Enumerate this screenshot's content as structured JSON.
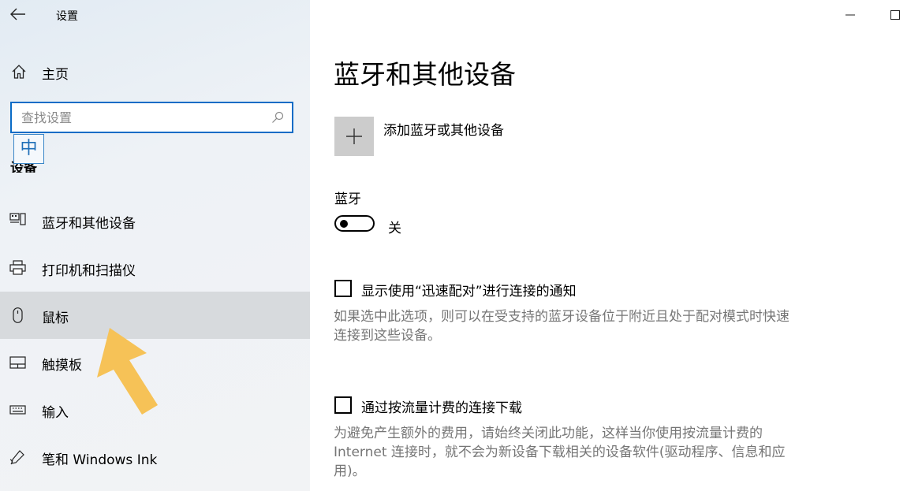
{
  "window": {
    "title": "设置"
  },
  "sidebar": {
    "home_label": "主页",
    "search_placeholder": "查找设置",
    "ime_indicator": "中",
    "section_heading": "设备",
    "items": [
      {
        "label": "蓝牙和其他设备",
        "icon": "bluetooth-devices-icon"
      },
      {
        "label": "打印机和扫描仪",
        "icon": "printer-icon"
      },
      {
        "label": "鼠标",
        "icon": "mouse-icon",
        "selected": true
      },
      {
        "label": "触摸板",
        "icon": "touchpad-icon"
      },
      {
        "label": "输入",
        "icon": "keyboard-icon"
      },
      {
        "label": "笔和 Windows Ink",
        "icon": "pen-icon"
      }
    ]
  },
  "main": {
    "title": "蓝牙和其他设备",
    "add_device_label": "添加蓝牙或其他设备",
    "bluetooth": {
      "label": "蓝牙",
      "state_label": "关",
      "on": false
    },
    "swift_pair": {
      "label": "显示使用“迅速配对”进行连接的通知",
      "checked": false,
      "description": "如果选中此选项，则可以在受支持的蓝牙设备位于附近且处于配对模式时快速连接到这些设备。"
    },
    "metered": {
      "label": "通过按流量计费的连接下载",
      "checked": false,
      "description": "为避免产生额外的费用，请始终关闭此功能，这样当你使用按流量计费的 Internet 连接时，就不会为新设备下载相关的设备软件(驱动程序、信息和应用)。"
    }
  },
  "colors": {
    "accent": "#0a6cc6",
    "selected_bg": "#d7dadd",
    "arrow": "#f6c257"
  }
}
